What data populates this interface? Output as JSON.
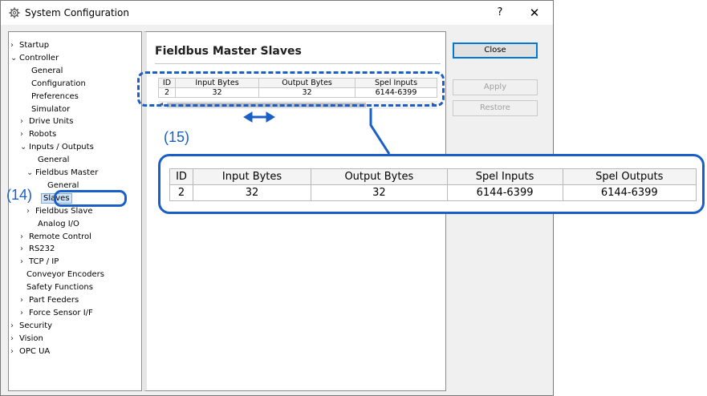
{
  "window": {
    "title": "System Configuration",
    "help_label": "?",
    "close_label": "✕"
  },
  "tree": {
    "items": [
      {
        "label": "Startup",
        "arrow": "›"
      },
      {
        "label": "Controller",
        "arrow": "⌄"
      },
      {
        "label": "General",
        "arrow": ""
      },
      {
        "label": "Configuration",
        "arrow": ""
      },
      {
        "label": "Preferences",
        "arrow": ""
      },
      {
        "label": "Simulator",
        "arrow": ""
      },
      {
        "label": "Drive Units",
        "arrow": "›"
      },
      {
        "label": "Robots",
        "arrow": "›"
      },
      {
        "label": "Inputs / Outputs",
        "arrow": "⌄"
      },
      {
        "label": "General",
        "arrow": ""
      },
      {
        "label": "Fieldbus Master",
        "arrow": "⌄"
      },
      {
        "label": "General",
        "arrow": ""
      },
      {
        "label": "Slaves",
        "arrow": ""
      },
      {
        "label": "Fieldbus Slave",
        "arrow": "›"
      },
      {
        "label": "Analog I/O",
        "arrow": ""
      },
      {
        "label": "Remote Control",
        "arrow": "›"
      },
      {
        "label": "RS232",
        "arrow": "›"
      },
      {
        "label": "TCP / IP",
        "arrow": "›"
      },
      {
        "label": "Conveyor Encoders",
        "arrow": ""
      },
      {
        "label": "Safety Functions",
        "arrow": ""
      },
      {
        "label": "Part Feeders",
        "arrow": "›"
      },
      {
        "label": "Force Sensor I/F",
        "arrow": "›"
      },
      {
        "label": "Security",
        "arrow": "›"
      },
      {
        "label": "Vision",
        "arrow": "›"
      },
      {
        "label": "OPC UA",
        "arrow": "›"
      }
    ]
  },
  "content": {
    "title": "Fieldbus Master Slaves",
    "table": {
      "headers": [
        "ID",
        "Input Bytes",
        "Output Bytes",
        "Spel Inputs"
      ],
      "rows": [
        [
          "2",
          "32",
          "32",
          "6144-6399"
        ]
      ]
    }
  },
  "buttons": {
    "close": "Close",
    "apply": "Apply",
    "restore": "Restore"
  },
  "annotations": {
    "a14": "(14)",
    "a15": "(15)",
    "zoom_table": {
      "headers": [
        "ID",
        "Input Bytes",
        "Output Bytes",
        "Spel Inputs",
        "Spel Outputs"
      ],
      "rows": [
        [
          "2",
          "32",
          "32",
          "6144-6399",
          "6144-6399"
        ]
      ]
    }
  },
  "colors": {
    "annotation": "#1a5fc7"
  }
}
